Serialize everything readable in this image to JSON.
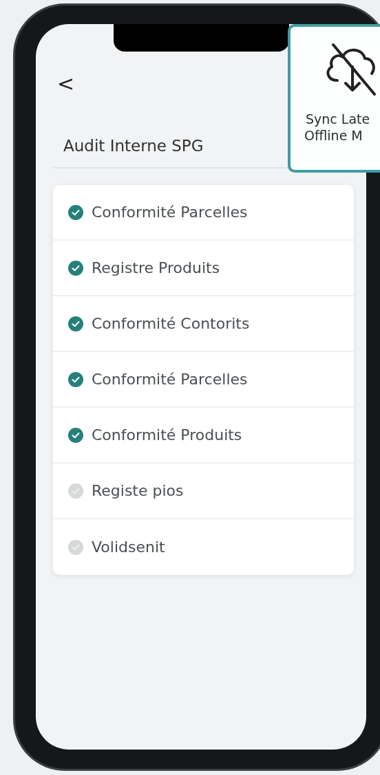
{
  "header": {
    "back": "<",
    "title": "Audit Interne SPG"
  },
  "sync_badge": {
    "lines": [
      "Sync Late",
      "Offline M"
    ]
  },
  "checklist": [
    {
      "label": "Conformité Parcelles",
      "checked": true
    },
    {
      "label": "Registre Produits",
      "checked": true
    },
    {
      "label": "Conformité Contorits",
      "checked": true
    },
    {
      "label": "Conformité Parcelles",
      "checked": true
    },
    {
      "label": "Conformité Produits",
      "checked": true
    },
    {
      "label": "Registe pios",
      "checked": false
    },
    {
      "label": "Volidsenit",
      "checked": false
    }
  ]
}
